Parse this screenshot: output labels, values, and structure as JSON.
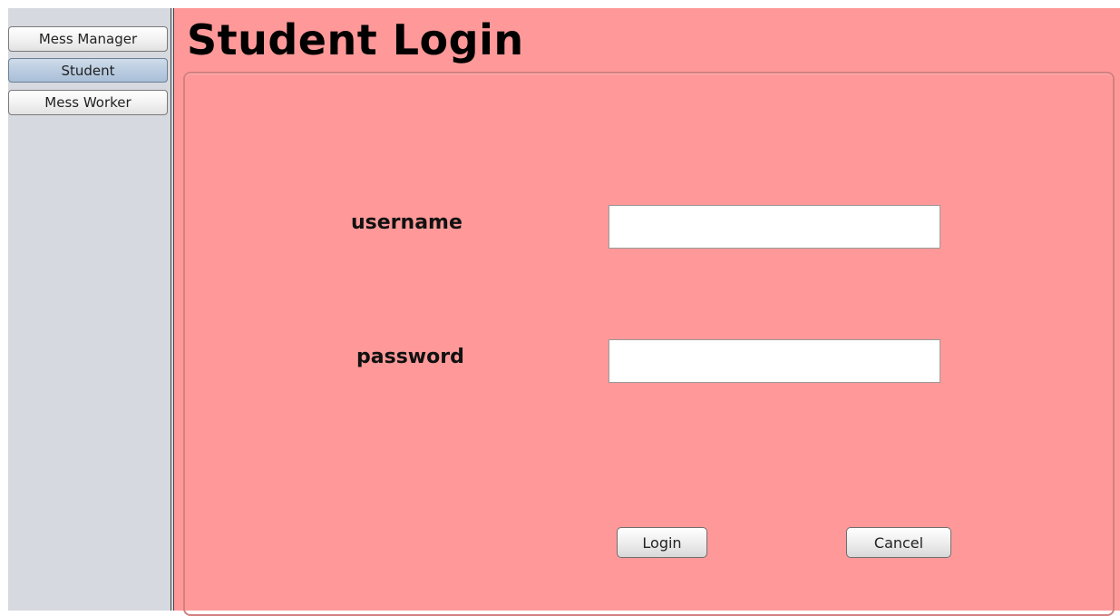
{
  "sidebar": {
    "items": [
      {
        "label": "Mess Manager",
        "selected": false
      },
      {
        "label": "Student",
        "selected": true
      },
      {
        "label": "Mess Worker",
        "selected": false
      }
    ]
  },
  "main": {
    "title": "Student Login",
    "background_color": "#ff9999",
    "form": {
      "username_label": "username",
      "username_value": "",
      "password_label": "password",
      "password_value": "",
      "login_label": "Login",
      "cancel_label": "Cancel"
    }
  }
}
